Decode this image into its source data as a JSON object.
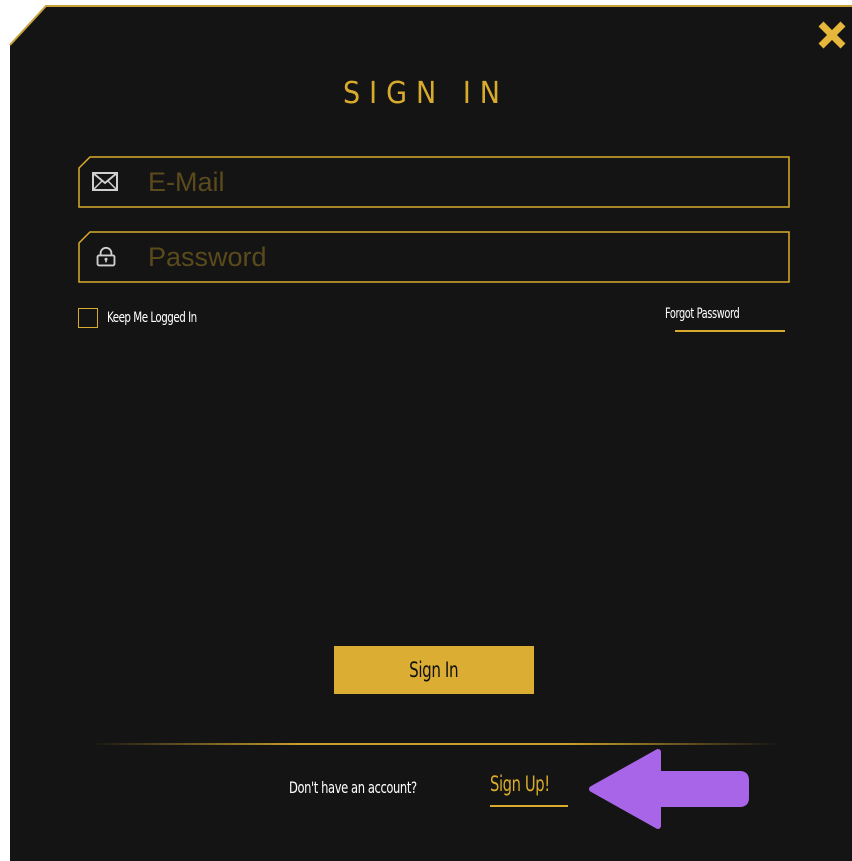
{
  "dialog": {
    "title": "SIGN IN",
    "accent_color": "#d9ab2c",
    "background_color": "#141414"
  },
  "email": {
    "placeholder": "E-Mail",
    "value": "",
    "icon": "envelope-icon"
  },
  "password": {
    "placeholder": "Password",
    "value": "",
    "icon": "lock-icon"
  },
  "options": {
    "keep_logged_in_label": "Keep Me Logged In",
    "keep_logged_in_checked": false,
    "forgot_password_label": "Forgot Password"
  },
  "actions": {
    "sign_in_label": "Sign In",
    "no_account_text": "Don't have an account?",
    "sign_up_label": "Sign Up!"
  },
  "annotation": {
    "icon": "arrow-left-icon",
    "color": "#a865e8"
  },
  "close": {
    "icon": "close-icon"
  }
}
